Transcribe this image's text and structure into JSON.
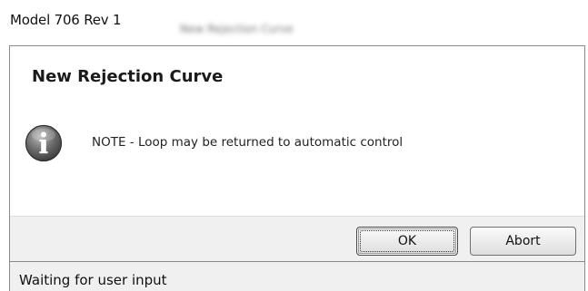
{
  "window": {
    "app_title": "Model 706 Rev 1",
    "blurred_title": "New Rejection Curve"
  },
  "dialog": {
    "title": "New Rejection Curve",
    "icon": "info-icon",
    "message": "NOTE - Loop may be returned to automatic control",
    "buttons": {
      "ok_label": "OK",
      "abort_label": "Abort"
    }
  },
  "status_bar": {
    "text": "Waiting for user input"
  }
}
